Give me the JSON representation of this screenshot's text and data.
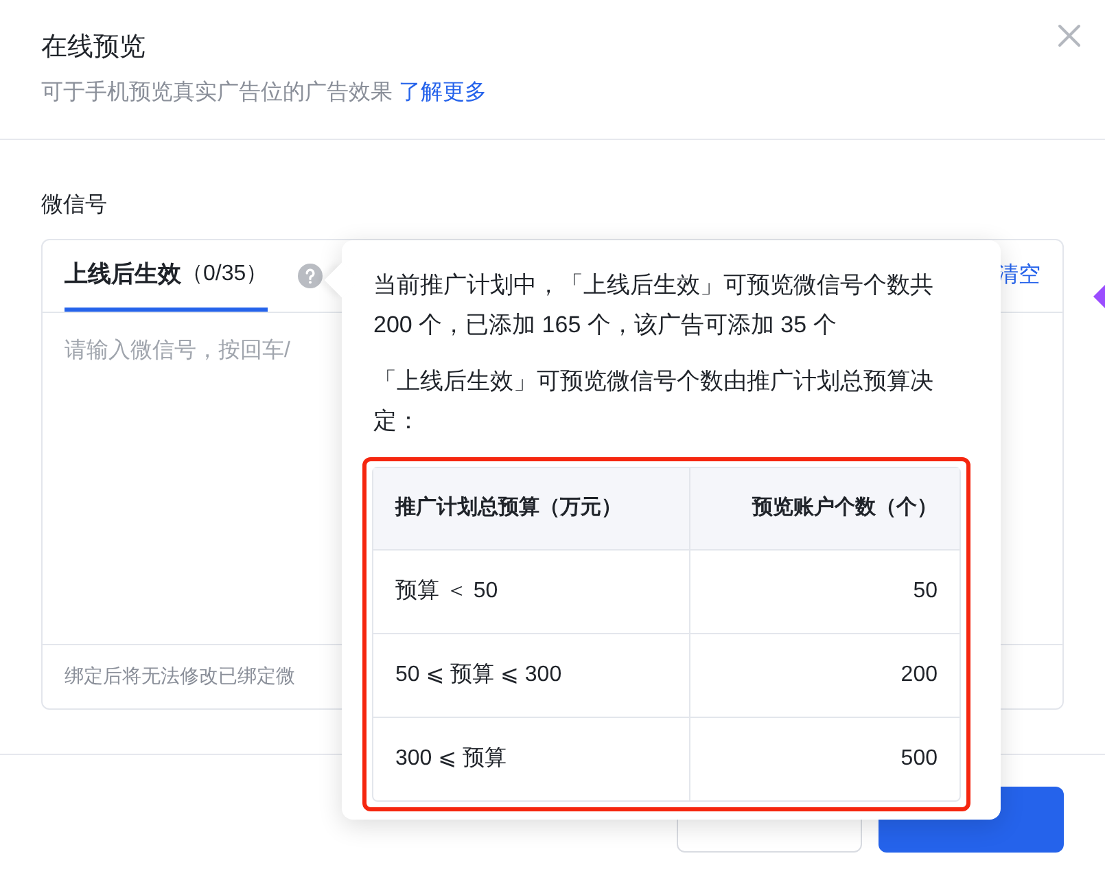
{
  "dialog": {
    "title": "在线预览",
    "subtitle": "可于手机预览真实广告位的广告效果",
    "learn_more_link": "了解更多"
  },
  "field": {
    "label": "微信号",
    "tabs": [
      {
        "label": "上线后生效",
        "count": "（0/35）",
        "selected": true
      }
    ],
    "clear_link": "清空",
    "placeholder": "请输入微信号，按回车/",
    "footer_note": "绑定后将无法修改已绑定微"
  },
  "tooltip": {
    "paragraphs": [
      "当前推广计划中，「上线后生效」可预览微信号个数共 200 个，已添加 165 个，该广告可添加 35 个",
      "「上线后生效」可预览微信号个数由推广计划总预算决定："
    ],
    "table": {
      "highlighted": true,
      "columns": [
        "推广计划总预算（万元）",
        "预览账户个数（个）"
      ],
      "rows": [
        [
          "预算 ＜ 50",
          "50"
        ],
        [
          "50 ⩽ 预算 ⩽ 300",
          "200"
        ],
        [
          "300 ⩽ 预算",
          "500"
        ]
      ]
    }
  },
  "buttons": [
    {
      "kind": "secondary"
    },
    {
      "kind": "primary"
    }
  ]
}
